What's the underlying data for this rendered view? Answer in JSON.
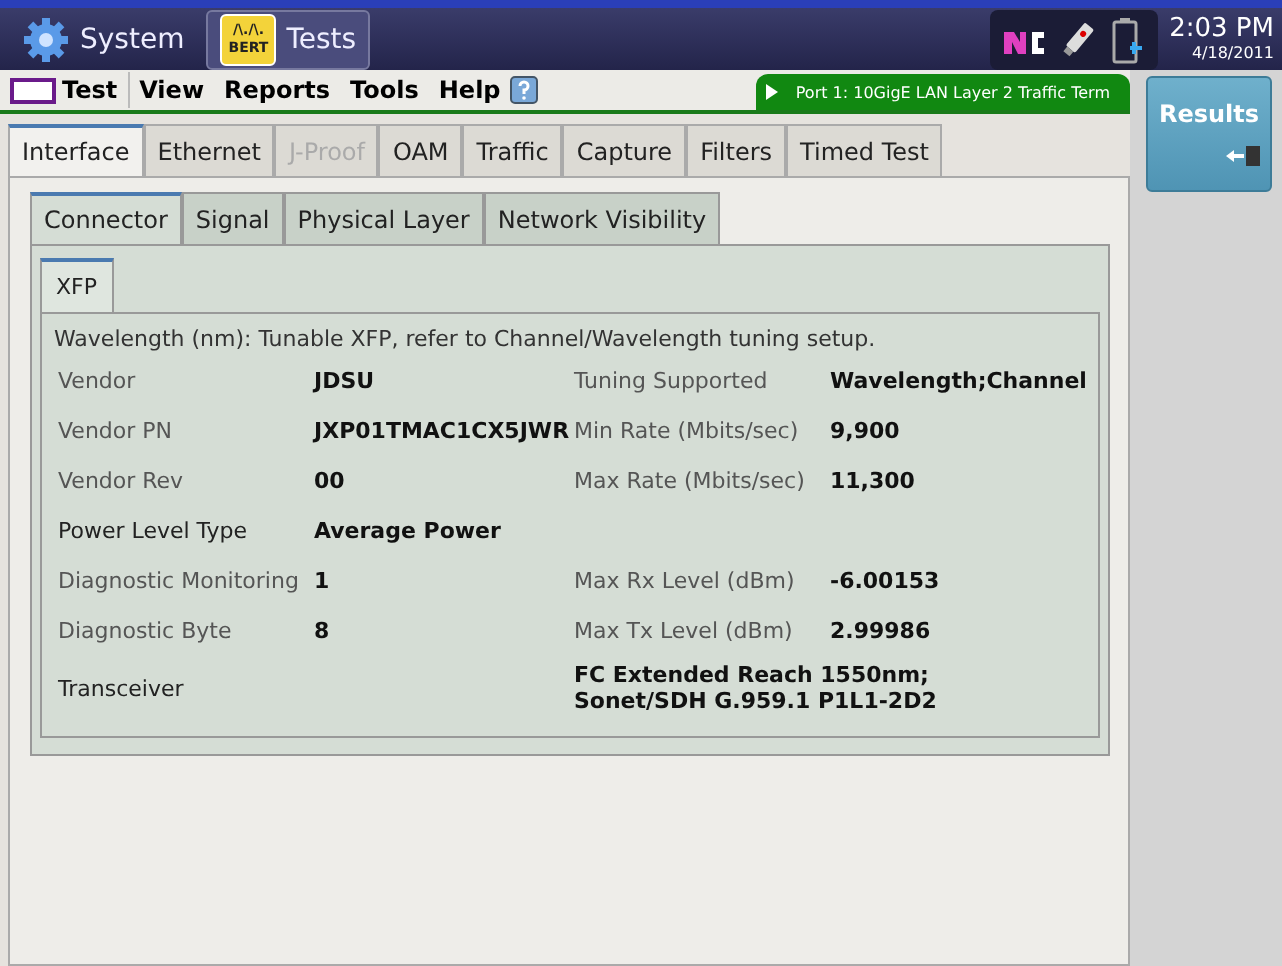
{
  "top_bar": {
    "apps": [
      {
        "label": "System",
        "kind": "system",
        "selected": false
      },
      {
        "label": "Tests",
        "kind": "tests",
        "badge_top": "/\\./\\.",
        "badge_bottom": "BERT",
        "selected": true
      }
    ],
    "time": "2:03 PM",
    "date": "4/18/2011"
  },
  "menu_bar": {
    "test_label": "Test",
    "items": [
      "View",
      "Reports",
      "Tools",
      "Help"
    ],
    "port": "Port 1: 10GigE LAN Layer 2 Traffic Term"
  },
  "tabs": [
    {
      "label": "Interface",
      "selected": true,
      "disabled": false
    },
    {
      "label": "Ethernet",
      "selected": false,
      "disabled": false
    },
    {
      "label": "J-Proof",
      "selected": false,
      "disabled": true
    },
    {
      "label": "OAM",
      "selected": false,
      "disabled": false
    },
    {
      "label": "Traffic",
      "selected": false,
      "disabled": false
    },
    {
      "label": "Capture",
      "selected": false,
      "disabled": false
    },
    {
      "label": "Filters",
      "selected": false,
      "disabled": false
    },
    {
      "label": "Timed Test",
      "selected": false,
      "disabled": false
    }
  ],
  "sub_tabs": [
    {
      "label": "Connector",
      "selected": true
    },
    {
      "label": "Signal",
      "selected": false
    },
    {
      "label": "Physical Layer",
      "selected": false
    },
    {
      "label": "Network Visibility",
      "selected": false
    }
  ],
  "module_tabs": [
    {
      "label": "XFP",
      "selected": true
    }
  ],
  "note": "Wavelength (nm): Tunable XFP, refer to Channel/Wavelength tuning setup.",
  "rows": [
    {
      "label": "Vendor",
      "value": "JDSU",
      "label_2": "Tuning Supported",
      "value_2": "Wavelength;Channel"
    },
    {
      "label": "Vendor PN",
      "value": "JXP01TMAC1CX5JWR",
      "label_2": "Min Rate (Mbits/sec)",
      "value_2": "9,900"
    },
    {
      "label": "Vendor Rev",
      "value": "00",
      "label_2": "Max Rate (Mbits/sec)",
      "value_2": "11,300"
    },
    {
      "label": "Power Level Type",
      "value": "Average Power"
    },
    {
      "label": "Diagnostic Monitoring",
      "value": "1",
      "label_2": "Max Rx Level (dBm)",
      "value_2": "-6.00153"
    },
    {
      "label": "Diagnostic Byte",
      "value": "8",
      "label_2": "Max Tx Level (dBm)",
      "value_2": "2.99986"
    },
    {
      "label": "Transceiver",
      "value_2": "FC Extended Reach 1550nm; Sonet/SDH G.959.1 P1L1-2D2"
    }
  ],
  "results_button": "Results"
}
